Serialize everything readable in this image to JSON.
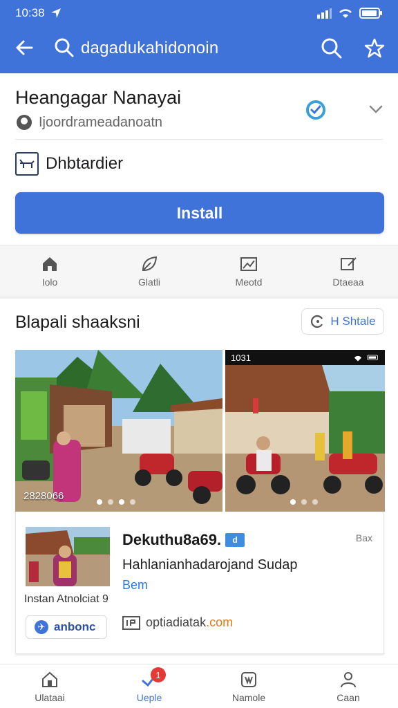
{
  "status_bar": {
    "time": "10:38"
  },
  "header": {
    "query": "dagadukahidonoin"
  },
  "app": {
    "title": "Heangagar Nanayai",
    "subtitle": "Ijoordrameadanoatn",
    "developer": "Dhbtardier",
    "install_label": "Install"
  },
  "actions": [
    {
      "label": "Iolo",
      "icon": "home-icon"
    },
    {
      "label": "Glatli",
      "icon": "leaf-icon"
    },
    {
      "label": "Meotd",
      "icon": "image-icon"
    },
    {
      "label": "Dtaeaa",
      "icon": "edit-icon"
    }
  ],
  "screenshots": {
    "title": "Blapali shaaksni",
    "share_label": "H Shtale",
    "shot1_label": "2828066",
    "shot2_time": "1031"
  },
  "info_card": {
    "title": "Dekuthu8a69.",
    "tag": "d",
    "size": "Bax",
    "subtitle": "Hahlanianhadarojand Sudap",
    "link": "Bem",
    "caption": "Instan Atnolciat 9",
    "badge_label": "anbonc",
    "site_prefix": "optiadiatak",
    "site_domain": ".com"
  },
  "bottom_nav": [
    {
      "label": "Ulataai",
      "icon": "home-icon"
    },
    {
      "label": "Ueple",
      "icon": "updates-icon",
      "badge": "1"
    },
    {
      "label": "Namole",
      "icon": "apps-icon"
    },
    {
      "label": "Caan",
      "icon": "profile-icon"
    }
  ],
  "colors": {
    "primary": "#3f73d9",
    "badge_red": "#e53935"
  }
}
